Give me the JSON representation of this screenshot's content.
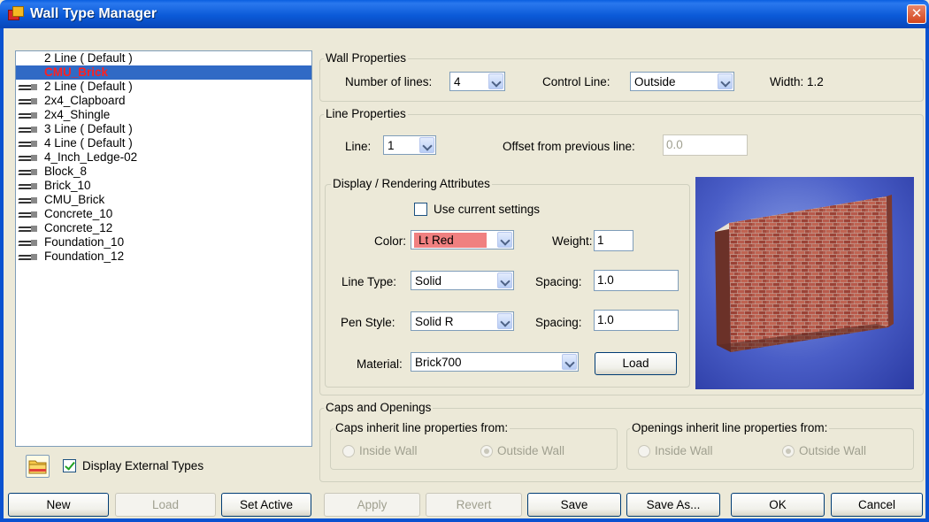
{
  "window": {
    "title": "Wall Type Manager",
    "close_glyph": "✕"
  },
  "wall_list": {
    "items": [
      {
        "label": "2 Line ( Default )",
        "icon": false,
        "selected": false
      },
      {
        "label": "CMU_Brick",
        "icon": false,
        "selected": true
      },
      {
        "label": "2 Line ( Default )",
        "icon": true,
        "selected": false
      },
      {
        "label": "2x4_Clapboard",
        "icon": true,
        "selected": false
      },
      {
        "label": "2x4_Shingle",
        "icon": true,
        "selected": false
      },
      {
        "label": "3 Line ( Default )",
        "icon": true,
        "selected": false
      },
      {
        "label": "4 Line ( Default )",
        "icon": true,
        "selected": false
      },
      {
        "label": "4_Inch_Ledge-02",
        "icon": true,
        "selected": false
      },
      {
        "label": "Block_8",
        "icon": true,
        "selected": false
      },
      {
        "label": "Brick_10",
        "icon": true,
        "selected": false
      },
      {
        "label": "CMU_Brick",
        "icon": true,
        "selected": false
      },
      {
        "label": "Concrete_10",
        "icon": true,
        "selected": false
      },
      {
        "label": "Concrete_12",
        "icon": true,
        "selected": false
      },
      {
        "label": "Foundation_10",
        "icon": true,
        "selected": false
      },
      {
        "label": "Foundation_12",
        "icon": true,
        "selected": false
      }
    ],
    "display_external_label": "Display External Types",
    "display_external_checked": true
  },
  "wall_properties": {
    "legend": "Wall Properties",
    "number_of_lines_label": "Number of lines:",
    "number_of_lines_value": "4",
    "control_line_label": "Control Line:",
    "control_line_value": "Outside",
    "width_text": "Width: 1.2"
  },
  "line_properties": {
    "legend": "Line Properties",
    "line_label": "Line:",
    "line_value": "1",
    "offset_label": "Offset from previous line:",
    "offset_value": "0.0"
  },
  "display_attributes": {
    "legend": "Display / Rendering Attributes",
    "use_current_label": "Use current settings",
    "use_current_checked": false,
    "color_label": "Color:",
    "color_value": "Lt Red",
    "color_hex": "#f08080",
    "weight_label": "Weight:",
    "weight_value": "1",
    "line_type_label": "Line Type:",
    "line_type_value": "Solid",
    "spacing1_label": "Spacing:",
    "spacing1_value": "1.0",
    "pen_style_label": "Pen Style:",
    "pen_style_value": "Solid R",
    "spacing2_label": "Spacing:",
    "spacing2_value": "1.0",
    "material_label": "Material:",
    "material_value": "Brick700",
    "load_label": "Load"
  },
  "caps_openings": {
    "legend": "Caps and Openings",
    "caps_legend": "Caps inherit line properties from:",
    "caps_inside": "Inside Wall",
    "caps_outside": "Outside Wall",
    "openings_legend": "Openings inherit line properties from:",
    "openings_inside": "Inside Wall",
    "openings_outside": "Outside Wall"
  },
  "buttons": {
    "new": "New",
    "load": "Load",
    "set_active": "Set Active",
    "apply": "Apply",
    "revert": "Revert",
    "save": "Save",
    "save_as": "Save As...",
    "ok": "OK",
    "cancel": "Cancel"
  },
  "colors": {
    "titlebar": "#0a5fe0",
    "selection": "#316ac5",
    "selected_text": "#ff2020",
    "preview_bg": "#4a5ec7"
  }
}
